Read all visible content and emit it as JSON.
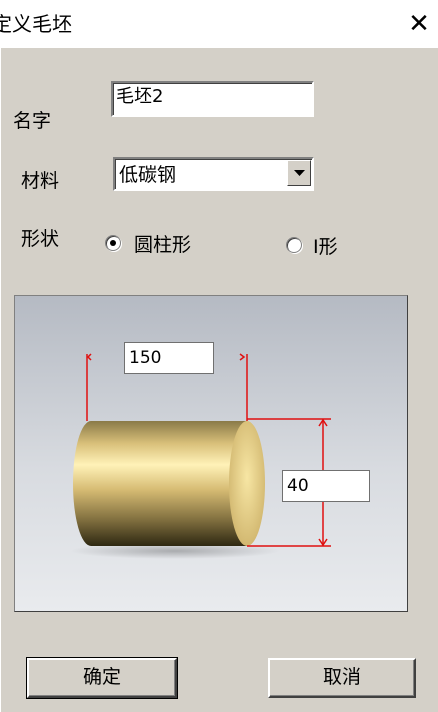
{
  "window": {
    "title": "定义毛坯",
    "close_glyph": "✕"
  },
  "form": {
    "name_label": "名字",
    "name_value": "毛坯2",
    "material_label": "材料",
    "material_value": "低碳钢",
    "shape_label": "形状",
    "shape_options": [
      {
        "label": "圆柱形",
        "selected": true
      },
      {
        "label": "I形",
        "selected": false
      }
    ]
  },
  "preview": {
    "length_value": "150",
    "diameter_value": "40",
    "colors": {
      "dimension_line": "#e01010",
      "cylinder": "#d9c07a"
    }
  },
  "buttons": {
    "ok_label": "确定",
    "cancel_label": "取消"
  }
}
